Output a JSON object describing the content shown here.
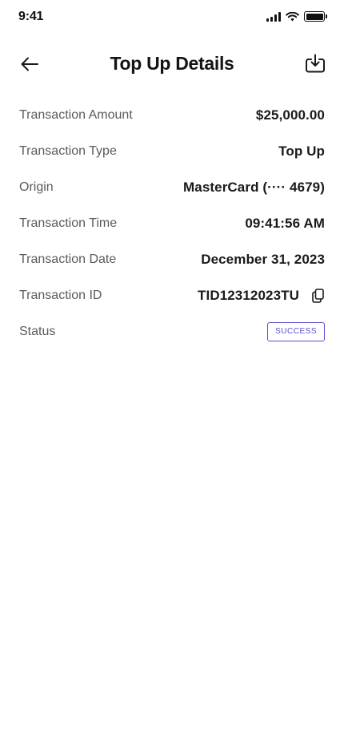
{
  "status_bar": {
    "time": "9:41"
  },
  "header": {
    "title": "Top Up Details"
  },
  "details": [
    {
      "label": "Transaction Amount",
      "value": "$25,000.00"
    },
    {
      "label": "Transaction Type",
      "value": "Top Up"
    },
    {
      "label": "Origin",
      "value": "MasterCard (···· 4679)"
    },
    {
      "label": "Transaction Time",
      "value": "09:41:56 AM"
    },
    {
      "label": "Transaction Date",
      "value": "December 31, 2023"
    },
    {
      "label": "Transaction ID",
      "value": "TID12312023TU"
    },
    {
      "label": "Status",
      "value": "SUCCESS"
    }
  ],
  "icons": {
    "back": "arrow-left-icon",
    "download": "download-icon",
    "copy": "copy-icon"
  },
  "colors": {
    "accent": "#5b4fd6",
    "text": "#1a1a1a",
    "label": "#5b5b5b"
  }
}
